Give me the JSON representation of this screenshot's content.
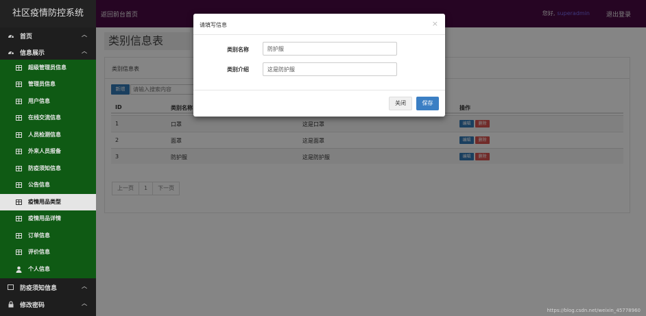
{
  "app": {
    "title": "社区疫情防控系统"
  },
  "header": {
    "back_link": "返回前台首页",
    "greeting": "您好,",
    "username": "superadmin",
    "logout": "退出登录"
  },
  "sidebar": {
    "top_items": [
      {
        "label": "首页",
        "icon": "dashboard-icon"
      },
      {
        "label": "信息展示",
        "icon": "dashboard-icon"
      }
    ],
    "sub_items": [
      {
        "label": "超级管理员信息"
      },
      {
        "label": "管理员信息"
      },
      {
        "label": "用户信息"
      },
      {
        "label": "在线交流信息"
      },
      {
        "label": "人员检测信息"
      },
      {
        "label": "外来人员报备"
      },
      {
        "label": "防疫须知信息"
      },
      {
        "label": "公告信息"
      },
      {
        "label": "疫情用品类型",
        "active": true
      },
      {
        "label": "疫情用品详情"
      },
      {
        "label": "订单信息"
      },
      {
        "label": "评价信息"
      }
    ],
    "personal": {
      "label": "个人信息"
    },
    "bottom_items": [
      {
        "label": "防疫须知信息"
      },
      {
        "label": "修改密码"
      }
    ]
  },
  "page": {
    "title": "类别信息表",
    "panel_title": "类别信息表",
    "new_button": "新增",
    "search_placeholder": "请输入搜索内容",
    "table": {
      "headers": {
        "id": "ID",
        "name": "类别名称",
        "actions": "操作"
      },
      "rows": [
        {
          "id": "1",
          "name": "口罩",
          "desc": "这是口罩"
        },
        {
          "id": "2",
          "name": "面罩",
          "desc": "这是面罩"
        },
        {
          "id": "3",
          "name": "防护服",
          "desc": "这是防护服"
        }
      ],
      "edit_label": "编辑",
      "delete_label": "删除"
    },
    "pager": {
      "prev": "上一页",
      "current": "1",
      "next": "下一页"
    }
  },
  "modal": {
    "title": "请填写信息",
    "close_symbol": "×",
    "fields": {
      "name_label": "类别名称",
      "name_value": "防护服",
      "desc_label": "类别介绍",
      "desc_value": "这是防护服"
    },
    "close_button": "关闭",
    "save_button": "保存"
  },
  "watermark": "https://blog.csdn.net/weixin_45778960",
  "colors": {
    "header_bg": "#4a0a44",
    "sidebar_bg": "#1e1e1e",
    "submenu_bg": "#0f5a14",
    "primary": "#337ab7",
    "danger": "#d9534f"
  }
}
